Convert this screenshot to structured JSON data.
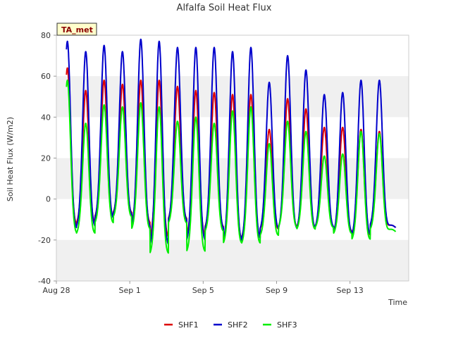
{
  "chart_data": {
    "type": "line",
    "title": "Alfalfa Soil Heat Flux",
    "xlabel": "Time",
    "ylabel": "Soil Heat Flux (W/m2)",
    "badge": "TA_met",
    "ylim": [
      -40,
      80
    ],
    "xlim": [
      0,
      19.2
    ],
    "x_axis_start": "Aug 28",
    "yticks": [
      -40,
      -20,
      0,
      20,
      40,
      60,
      80
    ],
    "xticks": [
      {
        "day": 0,
        "label": "Aug 28"
      },
      {
        "day": 4,
        "label": "Sep 1"
      },
      {
        "day": 8,
        "label": "Sep 5"
      },
      {
        "day": 12,
        "label": "Sep 9"
      },
      {
        "day": 16,
        "label": "Sep 13"
      }
    ],
    "grid": "alternating horizontal bands",
    "legend_position": "bottom-center",
    "days": [
      0.6,
      1.6,
      2.6,
      3.6,
      4.6,
      5.6,
      6.6,
      7.6,
      8.6,
      9.6,
      10.6,
      11.6,
      12.6,
      13.6,
      14.6,
      15.6,
      16.6,
      17.6
    ],
    "series": [
      {
        "name": "SHF1",
        "color": "#dd0000",
        "peaks": [
          64,
          53,
          58,
          56,
          58,
          58,
          55,
          53,
          52,
          51,
          51,
          34,
          49,
          44,
          35,
          35,
          34,
          33
        ],
        "troughs": [
          -14,
          -13,
          -10,
          -8,
          -13,
          -20,
          -11,
          -19,
          -15,
          -21,
          -20,
          -16,
          -15,
          -15,
          -15,
          -17,
          -19,
          -14
        ]
      },
      {
        "name": "SHF2",
        "color": "#0000cc",
        "peaks": [
          77,
          72,
          75,
          72,
          78,
          77,
          74,
          74,
          74,
          72,
          74,
          57,
          70,
          63,
          51,
          52,
          58,
          58
        ],
        "troughs": [
          -16,
          -15,
          -11,
          -9,
          -15,
          -24,
          -12,
          -22,
          -16,
          -22,
          -21,
          -16,
          -16,
          -16,
          -15,
          -18,
          -19,
          -14
        ]
      },
      {
        "name": "SHF3",
        "color": "#00ee00",
        "peaks": [
          58,
          37,
          46,
          45,
          47,
          45,
          38,
          40,
          37,
          43,
          45,
          27,
          38,
          33,
          21,
          22,
          33,
          32
        ],
        "troughs": [
          -18,
          -18,
          -13,
          -10,
          -16,
          -28,
          -13,
          -27,
          -17,
          -23,
          -23,
          -19,
          -15,
          -16,
          -15,
          -18,
          -21,
          -16
        ]
      }
    ]
  }
}
